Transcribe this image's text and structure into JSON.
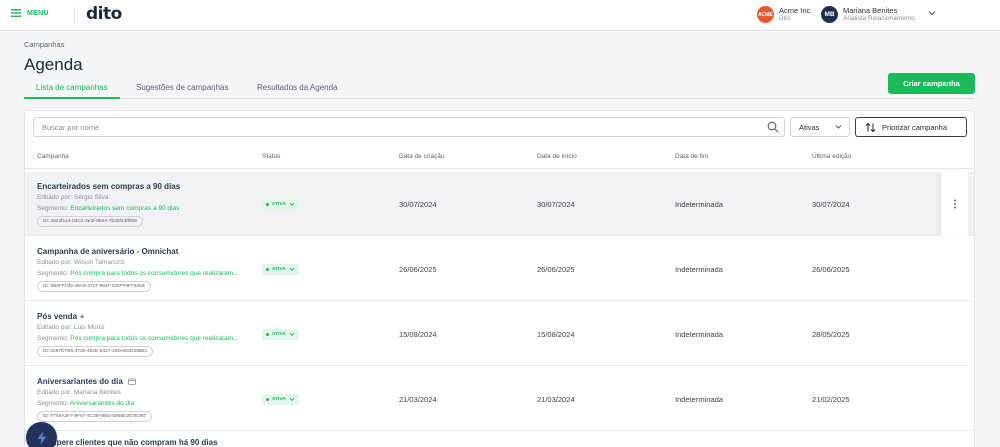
{
  "topbar": {
    "menu_label": "MENU",
    "logo": "dito",
    "org": {
      "avatar": "ACME",
      "name": "Acme Inc.",
      "sub": "Dito"
    },
    "user": {
      "initials": "MB",
      "name": "Mariana Benites",
      "role": "Analista Relacionamento"
    }
  },
  "breadcrumb": "Campanhas",
  "page_title": "Agenda",
  "tabs": [
    {
      "label": "Lista de campanhas",
      "active": true
    },
    {
      "label": "Sugestões de campanhas",
      "active": false
    },
    {
      "label": "Resultados da Agenda",
      "active": false
    }
  ],
  "create_button": "Criar campanha",
  "filters": {
    "search_placeholder": "Buscar por nome",
    "status_select": "Ativas",
    "prioritize_button": "Priorizar campanha"
  },
  "table": {
    "columns": [
      "Campanha",
      "Status",
      "Data de criação",
      "Data de início",
      "Data de fim",
      "Última edição"
    ],
    "rows": [
      {
        "name": "Encarteirados sem compras a 90 dias",
        "editor": "Editado por: Sérgio Silva",
        "segment_label": "Segmento: ",
        "segment": "Encarteirados sem compras a 90 dias",
        "id": "ID: 3942f144-04C2-4e3f-9b9A-7b25f34ff0b9",
        "status": "ATIVA",
        "created": "30/07/2024",
        "start": "30/07/2024",
        "end": "Indeterminada",
        "edited": "30/07/2024"
      },
      {
        "name": "Campanha de aniversário - Omnichat",
        "editor": "Editado por: Wilson Tamarozzi",
        "segment_label": "Segmento: ",
        "segment": "Pós compra para todos os consumidores que realizaram...",
        "id": "ID: 0B0FFf4f5-46A9-4717-994F-D0IFF8FF5469",
        "status": "ATIVA",
        "created": "26/06/2025",
        "start": "26/06/2025",
        "end": "Indeterminada",
        "edited": "26/06/2025"
      },
      {
        "name": "Pós venda",
        "name_icon": "star-icon",
        "editor": "Editado por: Luis Muniz",
        "segment_label": "Segmento: ",
        "segment": "Pós compra para todos os consumidores que realizaram...",
        "id": "ID: 0287D7B6-3700-492E-8427-24DAE8D35B51",
        "status": "ATIVA",
        "created": "15/08/2024",
        "start": "15/08/2024",
        "end": "Indeterminada",
        "edited": "28/05/2025"
      },
      {
        "name": "Aniversariantes do dia",
        "name_icon": "calendar-icon",
        "editor": "Editado por: Mariana Benites",
        "segment_label": "Segmento: ",
        "segment": "Aniversariantes do dia",
        "id": "ID: F756A3F7-9F97-4C29-8593-5956D2E7E387",
        "status": "ATIVA",
        "created": "21/03/2024",
        "start": "21/03/2024",
        "end": "Indeterminada",
        "edited": "21/02/2025"
      },
      {
        "name": "Recupere clientes que não compram há 90 dias"
      }
    ]
  },
  "colors": {
    "accent": "#1eb95a",
    "navy": "#21335a",
    "org": "#e9572b"
  }
}
